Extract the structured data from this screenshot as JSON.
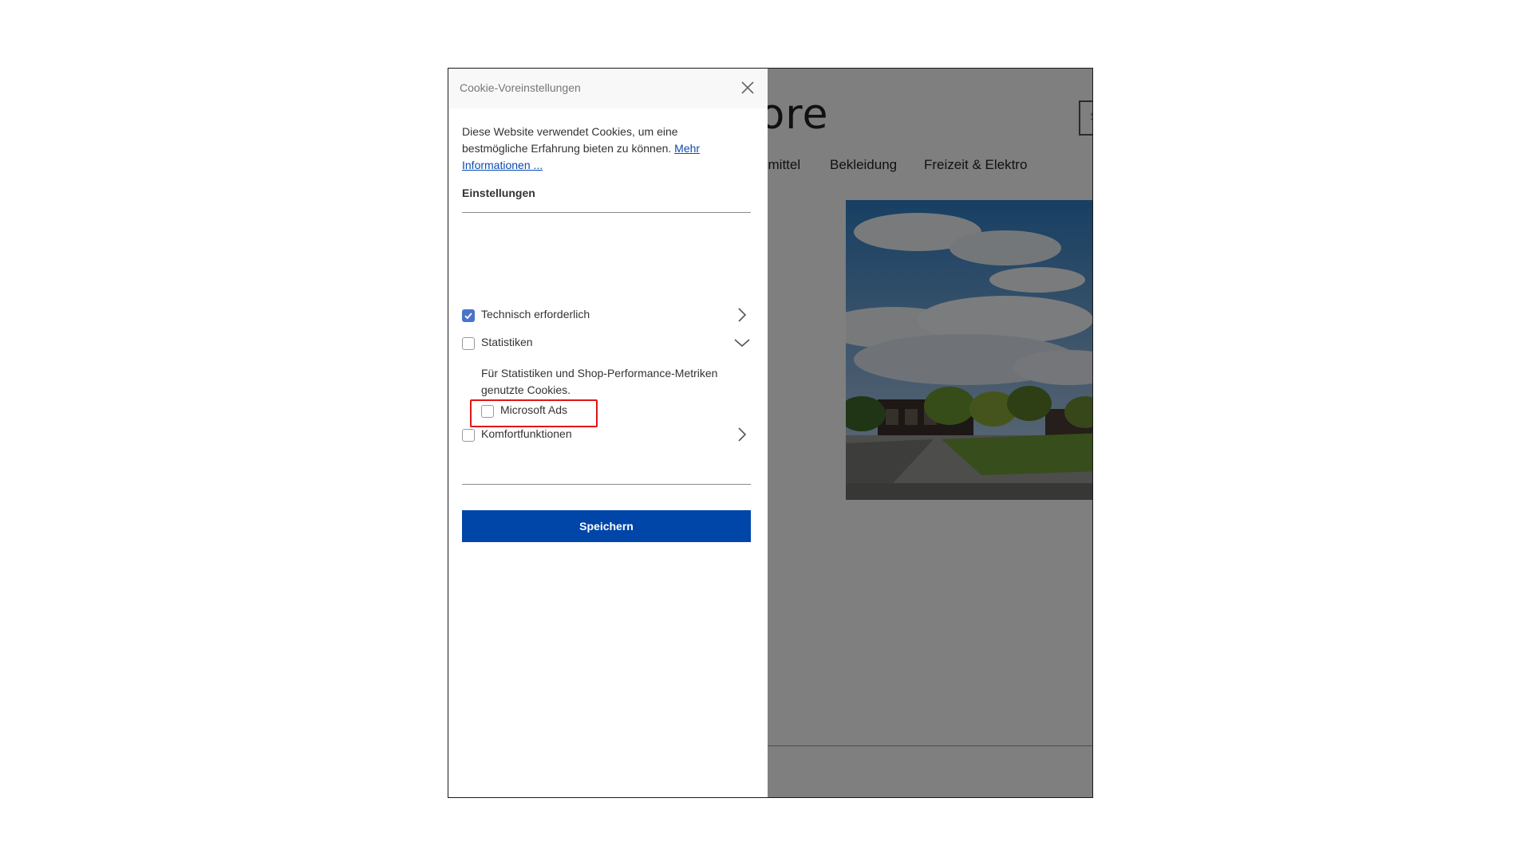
{
  "shop": {
    "logo_text": "store",
    "search_placeholder": "S",
    "nav": [
      "smittel",
      "Bekleidung",
      "Freizeit & Elektro"
    ]
  },
  "cookie_panel": {
    "title": "Cookie-Voreinstellungen",
    "close_icon": "close-icon",
    "intro_text": "Diese Website verwendet Cookies, um eine bestmögliche Erfahrung bieten zu können.",
    "more_info_link": "Mehr Informationen ...",
    "settings_heading": "Einstellungen",
    "groups": [
      {
        "label": "Technisch erforderlich",
        "checked": true,
        "expanded": false,
        "icon": "chevron-right-icon"
      },
      {
        "label": "Statistiken",
        "checked": false,
        "expanded": true,
        "icon": "chevron-down-icon",
        "description": "Für Statistiken und Shop-Performance-Metriken genutzte Cookies.",
        "items": [
          {
            "label": "Microsoft Ads",
            "checked": false
          }
        ]
      },
      {
        "label": "Komfortfunktionen",
        "checked": false,
        "expanded": false,
        "icon": "chevron-right-icon"
      }
    ],
    "save_label": "Speichern"
  },
  "colors": {
    "primary_button": "#0045a8",
    "checkbox_checked": "#4a74c9",
    "link": "#0a4bb1",
    "highlight": "#e01414"
  }
}
